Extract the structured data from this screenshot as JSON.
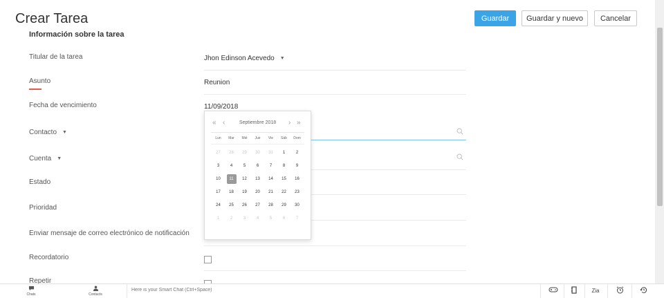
{
  "header": {
    "title": "Crear Tarea",
    "save_label": "Guardar",
    "save_new_label": "Guardar y nuevo",
    "cancel_label": "Cancelar",
    "accent_color": "#3ba4e6"
  },
  "section": {
    "title": "Información sobre la tarea"
  },
  "form": {
    "owner": {
      "label": "Titular de la tarea",
      "value": "Jhon Edinson Acevedo"
    },
    "subject": {
      "label": "Asunto",
      "value": "Reunion"
    },
    "due_date": {
      "label": "Fecha de vencimiento",
      "value": "11/09/2018"
    },
    "contact": {
      "label": "Contacto"
    },
    "account": {
      "label": "Cuenta"
    },
    "status": {
      "label": "Estado"
    },
    "priority": {
      "label": "Prioridad"
    },
    "notify": {
      "label": "Enviar mensaje de correo electrónico de notificación"
    },
    "reminder": {
      "label": "Recordatorio"
    },
    "repeat": {
      "label": "Repetir"
    }
  },
  "datepicker": {
    "month_title": "Septiembre 2018",
    "prev_year": "«",
    "prev_month": "‹",
    "next_month": "›",
    "next_year": "»",
    "weekdays": [
      "Lun",
      "Mar",
      "Mié",
      "Jue",
      "Vie",
      "Sáb",
      "Dom"
    ],
    "days": [
      {
        "n": "27",
        "muted": true
      },
      {
        "n": "28",
        "muted": true
      },
      {
        "n": "29",
        "muted": true
      },
      {
        "n": "30",
        "muted": true
      },
      {
        "n": "31",
        "muted": true
      },
      {
        "n": "1"
      },
      {
        "n": "2"
      },
      {
        "n": "3"
      },
      {
        "n": "4"
      },
      {
        "n": "5"
      },
      {
        "n": "6"
      },
      {
        "n": "7"
      },
      {
        "n": "8"
      },
      {
        "n": "9"
      },
      {
        "n": "10"
      },
      {
        "n": "11",
        "selected": true
      },
      {
        "n": "12"
      },
      {
        "n": "13"
      },
      {
        "n": "14"
      },
      {
        "n": "15"
      },
      {
        "n": "16"
      },
      {
        "n": "17"
      },
      {
        "n": "18"
      },
      {
        "n": "19"
      },
      {
        "n": "20"
      },
      {
        "n": "21"
      },
      {
        "n": "22"
      },
      {
        "n": "23"
      },
      {
        "n": "24"
      },
      {
        "n": "25"
      },
      {
        "n": "26"
      },
      {
        "n": "27"
      },
      {
        "n": "28"
      },
      {
        "n": "29"
      },
      {
        "n": "30"
      },
      {
        "n": "1",
        "muted": true
      },
      {
        "n": "2",
        "muted": true
      },
      {
        "n": "3",
        "muted": true
      },
      {
        "n": "4",
        "muted": true
      },
      {
        "n": "5",
        "muted": true
      },
      {
        "n": "6",
        "muted": true
      },
      {
        "n": "7",
        "muted": true
      }
    ]
  },
  "bottombar": {
    "chats_label": "Chats",
    "contacts_label": "Contacts",
    "smart_chat_placeholder": "Here is your Smart Chat (Ctrl+Space)",
    "icons": [
      "gamepad-icon",
      "notebook-icon",
      "zia-icon",
      "alarm-icon",
      "history-icon"
    ],
    "zia_label": "Zia"
  }
}
